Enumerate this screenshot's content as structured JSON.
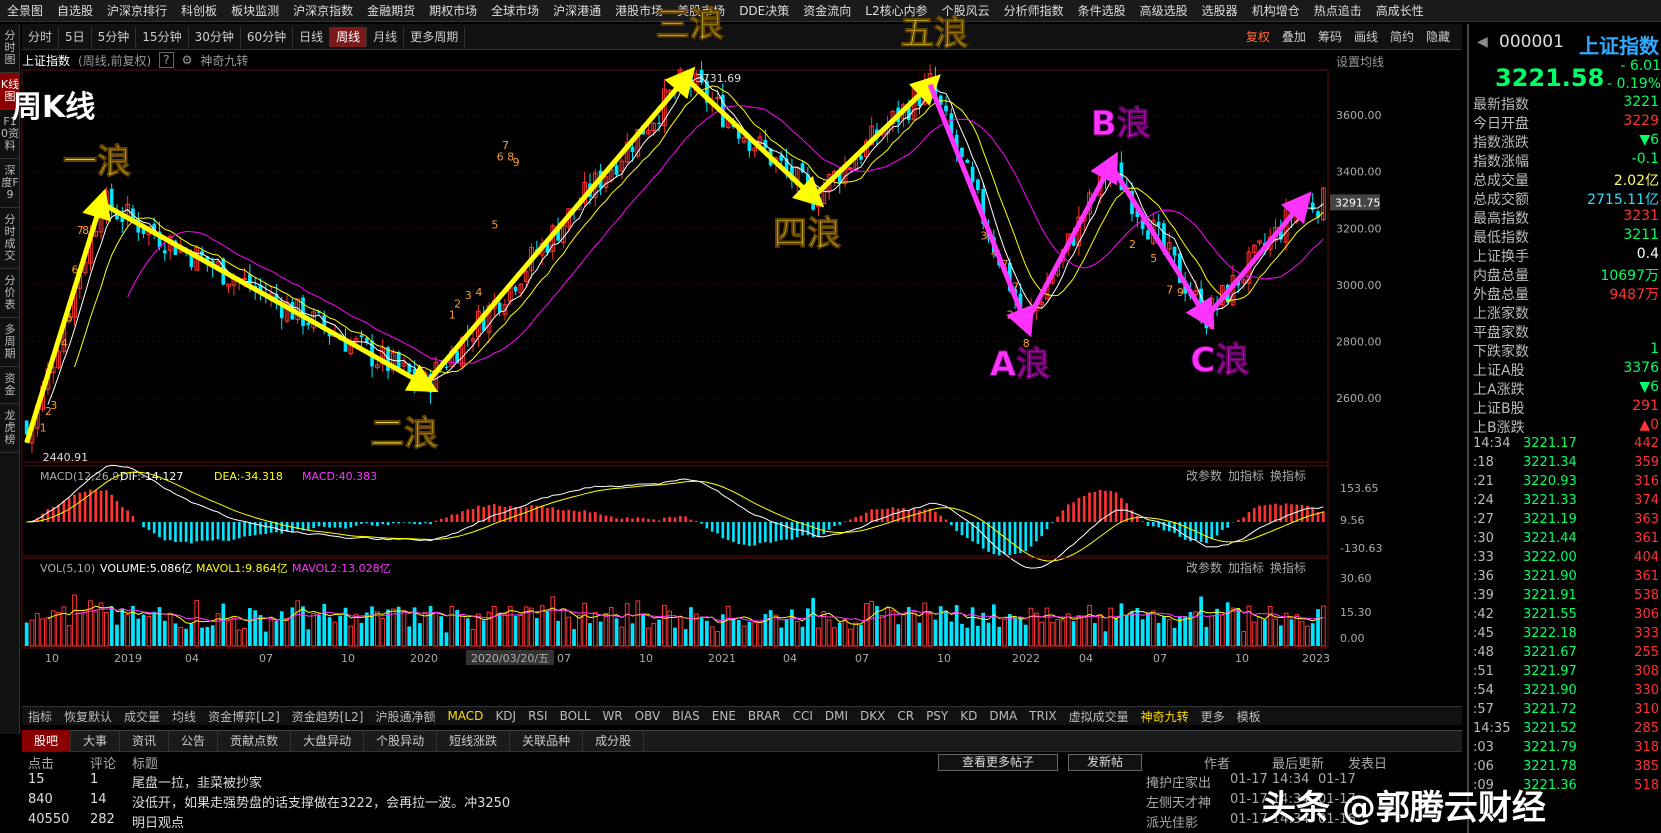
{
  "top_menu": [
    "全景图",
    "自选股",
    "沪深京排行",
    "科创板",
    "板块监测",
    "沪深京指数",
    "金融期货",
    "期权市场",
    "全球市场",
    "沪深港通",
    "港股市场",
    "美股市场",
    "DDE决策",
    "资金流向",
    "L2核心内参",
    "个股风云",
    "分析师指数",
    "条件选股",
    "高级选股",
    "选股器",
    "机构增仓",
    "热点追击",
    "高成长性"
  ],
  "period_buttons": [
    "分时",
    "5日",
    "5分钟",
    "15分钟",
    "30分钟",
    "60分钟",
    "日线",
    "周线",
    "月线",
    "更多周期"
  ],
  "period_active": "周线",
  "period_tools": [
    "复权",
    "叠加",
    "筹码",
    "画线",
    "简约",
    "隐藏"
  ],
  "left_sidebar": [
    "分时图",
    "K线图",
    "F10资料",
    "深度F9",
    "分时成交",
    "分价表",
    "多周期",
    "资金",
    "龙虎榜"
  ],
  "left_active": "K线图",
  "chart_header": {
    "title": "上证指数",
    "subtitle": "(周线,前复权)",
    "help": "?",
    "indicator": "神奇九转",
    "set_ma": "设置均线",
    "week_title": "周K线"
  },
  "chart_data": {
    "type": "candlestick",
    "title": "上证指数 (周线,前复权)",
    "x_ticks": [
      "10",
      "2019",
      "04",
      "07",
      "10",
      "2020",
      "2020/03/20/五",
      "07",
      "10",
      "2021",
      "04",
      "07",
      "10",
      "2022",
      "04",
      "07",
      "10",
      "2023"
    ],
    "y_ticks": [
      2600,
      2800,
      3000,
      3200,
      3400,
      3600
    ],
    "ylim": [
      2380,
      3760
    ],
    "current_price_label": "3291.75",
    "high_label": "3731.69",
    "low_label": "2440.91",
    "wave_points": [
      {
        "label": "一浪",
        "date_index": 14,
        "value": 3290
      },
      {
        "label": "二浪",
        "date_index": 75,
        "value": 2646
      },
      {
        "label": "三浪",
        "date_index": 124,
        "value": 3731.69
      },
      {
        "label": "四浪",
        "date_index": 148,
        "value": 3310
      },
      {
        "label": "五浪",
        "date_index": 170,
        "value": 3708
      },
      {
        "label": "A浪",
        "date_index": 188,
        "value": 2863
      },
      {
        "label": "B浪",
        "date_index": 204,
        "value": 3424
      },
      {
        "label": "C浪",
        "date_index": 222,
        "value": 2885
      }
    ],
    "wave_start": {
      "date_index": 0,
      "value": 2440.91
    },
    "wave_end_arrow": {
      "date_index": 240,
      "value": 3290
    },
    "td_counts": [
      {
        "t": "1",
        "i": 3,
        "v": 2480
      },
      {
        "t": "2",
        "i": 4,
        "v": 2540
      },
      {
        "t": "3",
        "i": 5,
        "v": 2560
      },
      {
        "t": "4",
        "i": 7,
        "v": 2780
      },
      {
        "t": "5",
        "i": 8,
        "v": 2870
      },
      {
        "t": "6",
        "i": 9,
        "v": 3040
      },
      {
        "t": "7",
        "i": 10,
        "v": 3180
      },
      {
        "t": "8",
        "i": 11,
        "v": 3180
      },
      {
        "t": "1",
        "i": 80,
        "v": 2880
      },
      {
        "t": "2",
        "i": 81,
        "v": 2920
      },
      {
        "t": "3",
        "i": 83,
        "v": 2950
      },
      {
        "t": "4",
        "i": 85,
        "v": 2960
      },
      {
        "t": "5",
        "i": 88,
        "v": 3200
      },
      {
        "t": "6",
        "i": 89,
        "v": 3440
      },
      {
        "t": "7",
        "i": 90,
        "v": 3480
      },
      {
        "t": "8",
        "i": 91,
        "v": 3440
      },
      {
        "t": "9",
        "i": 92,
        "v": 3420
      },
      {
        "t": "3",
        "i": 180,
        "v": 3160
      },
      {
        "t": "5",
        "i": 181,
        "v": 3160
      },
      {
        "t": "4",
        "i": 182,
        "v": 3100
      },
      {
        "t": "7",
        "i": 184,
        "v": 3060
      },
      {
        "t": "2",
        "i": 185,
        "v": 2880
      },
      {
        "t": "7",
        "i": 186,
        "v": 2980
      },
      {
        "t": "8",
        "i": 188,
        "v": 2780
      },
      {
        "t": "2",
        "i": 208,
        "v": 3130
      },
      {
        "t": "5",
        "i": 212,
        "v": 3080
      },
      {
        "t": "7",
        "i": 215,
        "v": 2970
      },
      {
        "t": "9",
        "i": 217,
        "v": 2960
      }
    ],
    "macd": {
      "label": "MACD(12,26,9)",
      "dif": "DIF:-14.127",
      "dea": "DEA:-34.318",
      "macd": "MACD:40.383",
      "y_ticks": [
        "153.65",
        "9.56",
        "-130.63"
      ]
    },
    "vol": {
      "label": "VOL(5,10)",
      "volume": "VOLUME:5.086亿",
      "mavol1": "MAVOL1:9.864亿",
      "mavol2": "MAVOL2:13.028亿",
      "y_ticks": [
        "30.60",
        "15.30",
        "0.00"
      ]
    },
    "panel_tools": [
      "改参数",
      "加指标",
      "换指标"
    ]
  },
  "right_panel": {
    "code": "000001",
    "name": "上证指数",
    "price": "3221.58",
    "change": "- 6.01",
    "change_pct": "- 0.19%",
    "stats": [
      {
        "k": "最新指数",
        "v": "3221",
        "c": "#00ff66"
      },
      {
        "k": "今日开盘",
        "v": "3229",
        "c": "#ff3333"
      },
      {
        "k": "指数涨跌",
        "v": "▼6",
        "c": "#00ff66"
      },
      {
        "k": "指数涨幅",
        "v": "-0.1",
        "c": "#00ff66"
      },
      {
        "k": "总成交量",
        "v": "2.02亿",
        "c": "#ffff66"
      },
      {
        "k": "总成交额",
        "v": "2715.11亿",
        "c": "#33ddff"
      },
      {
        "k": "最高指数",
        "v": "3231",
        "c": "#ff3333"
      },
      {
        "k": "最低指数",
        "v": "3211",
        "c": "#00ff66"
      },
      {
        "k": "上证换手",
        "v": "0.4",
        "c": "#ffffff"
      },
      {
        "k": "内盘总量",
        "v": "10697万",
        "c": "#00ff66"
      },
      {
        "k": "外盘总量",
        "v": "9487万",
        "c": "#ff3333"
      },
      {
        "k": "上涨家数",
        "v": "",
        "c": "#ff3333"
      },
      {
        "k": "平盘家数",
        "v": "",
        "c": "#ffffff"
      },
      {
        "k": "下跌家数",
        "v": "1",
        "c": "#00ff66"
      },
      {
        "k": "上证A股",
        "v": "3376",
        "c": "#00ff66"
      },
      {
        "k": "上A涨跌",
        "v": "▼6",
        "c": "#00ff66"
      },
      {
        "k": "上证B股",
        "v": "291",
        "c": "#ff3333"
      },
      {
        "k": "上B涨跌",
        "v": "▲0",
        "c": "#ff3333"
      }
    ],
    "ticks": [
      {
        "t": "14:34",
        "p": "3221.17",
        "v": "442"
      },
      {
        "t": ":18",
        "p": "3221.34",
        "v": "359"
      },
      {
        "t": ":21",
        "p": "3220.93",
        "v": "316"
      },
      {
        "t": ":24",
        "p": "3221.33",
        "v": "374"
      },
      {
        "t": ":27",
        "p": "3221.19",
        "v": "363"
      },
      {
        "t": ":30",
        "p": "3221.44",
        "v": "361"
      },
      {
        "t": ":33",
        "p": "3222.00",
        "v": "404"
      },
      {
        "t": ":36",
        "p": "3221.90",
        "v": "361"
      },
      {
        "t": ":39",
        "p": "3221.91",
        "v": "538"
      },
      {
        "t": ":42",
        "p": "3221.55",
        "v": "306"
      },
      {
        "t": ":45",
        "p": "3222.18",
        "v": "333"
      },
      {
        "t": ":48",
        "p": "3221.67",
        "v": "255"
      },
      {
        "t": ":51",
        "p": "3221.97",
        "v": "308"
      },
      {
        "t": ":54",
        "p": "3221.90",
        "v": "330"
      },
      {
        "t": ":57",
        "p": "3221.72",
        "v": "310"
      },
      {
        "t": "14:35",
        "p": "3221.52",
        "v": "285"
      },
      {
        "t": ":03",
        "p": "3221.79",
        "v": "318"
      },
      {
        "t": ":06",
        "p": "3221.78",
        "v": "385"
      },
      {
        "t": ":09",
        "p": "3221.36",
        "v": "518"
      }
    ]
  },
  "indicator_tabs": [
    "指标",
    "恢复默认",
    "成交量",
    "均线",
    "资金博弈[L2]",
    "资金趋势[L2]",
    "沪股通净额",
    "MACD",
    "KDJ",
    "RSI",
    "BOLL",
    "WR",
    "OBV",
    "BIAS",
    "ENE",
    "BRAR",
    "CCI",
    "DMI",
    "DKX",
    "CR",
    "PSY",
    "KD",
    "DMA",
    "TRIX",
    "虚拟成交量",
    "神奇九转",
    "更多",
    "模板"
  ],
  "bottom_tabs": [
    "股吧",
    "大事",
    "资讯",
    "公告",
    "贡献点数",
    "大盘异动",
    "个股异动",
    "短线涨跌",
    "关联品种",
    "成分股"
  ],
  "post_header": [
    "点击",
    "评论",
    "标题",
    "作者",
    "最后更新",
    "发表日"
  ],
  "post_buttons": [
    "查看更多帖子",
    "发新帖"
  ],
  "posts": [
    {
      "clicks": "15",
      "comments": "1",
      "title": "尾盘一拉，韭菜被抄家",
      "author": "掩护庄家出",
      "time": "01-17 14:34",
      "date": "01-17"
    },
    {
      "clicks": "840",
      "comments": "14",
      "title": "没低开，如果走强势盘的话支撑做在3222，会再拉一波。冲3250",
      "author": "左侧天才神",
      "time": "01-17 14:34",
      "date": "01-17"
    },
    {
      "clicks": "40550",
      "comments": "282",
      "title": "明日观点",
      "author": "派光佳影",
      "time": "01-17 14:34",
      "date": "01-16"
    }
  ],
  "watermark": "头条 @郭腾云财经"
}
